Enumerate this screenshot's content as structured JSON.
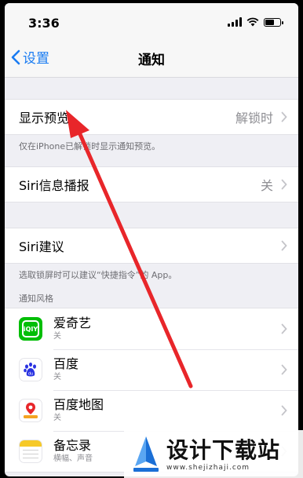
{
  "status": {
    "time": "3:36"
  },
  "nav": {
    "back_label": "设置",
    "title": "通知"
  },
  "show_preview": {
    "label": "显示预览",
    "value": "解锁时",
    "footnote": "仅在iPhone已解锁时显示通知预览。"
  },
  "siri_announce": {
    "label": "Siri信息播报",
    "value": "关"
  },
  "siri_suggestions": {
    "label": "Siri建议",
    "footnote": "选取锁屏时可以建议“快捷指令”的 App。"
  },
  "notification_style": {
    "header": "通知风格",
    "apps": [
      {
        "name": "爱奇艺",
        "detail": "关",
        "icon": "iqiyi-icon"
      },
      {
        "name": "百度",
        "detail": "关",
        "icon": "baidu-icon"
      },
      {
        "name": "百度地图",
        "detail": "关",
        "icon": "baidu-map-icon"
      },
      {
        "name": "备忘录",
        "detail": "横幅、声音",
        "icon": "notes-icon"
      }
    ]
  },
  "watermark": {
    "title": "设计下载站",
    "url": "www.shejizhaji.com"
  },
  "colors": {
    "ios_blue": "#1a7cf2",
    "annotation_red": "#e8262a",
    "iqiyi_green": "#00be06"
  }
}
